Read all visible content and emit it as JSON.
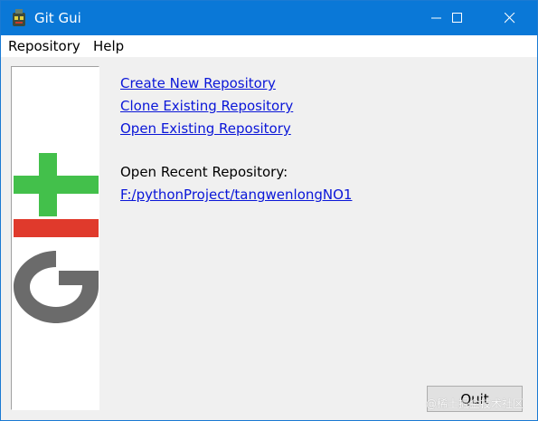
{
  "window": {
    "title": "Git Gui"
  },
  "menubar": {
    "items": [
      {
        "label": "Repository"
      },
      {
        "label": "Help"
      }
    ]
  },
  "actions": {
    "create": "Create New Repository",
    "clone": "Clone Existing Repository",
    "open": "Open Existing Repository"
  },
  "recent": {
    "label": "Open Recent Repository:",
    "items": [
      {
        "path": "F:/pythonProject/tangwenlongNO1"
      }
    ]
  },
  "footer": {
    "quit_label": "Quit",
    "watermark": "@稀土掘金技术社区"
  },
  "colors": {
    "titlebar": "#0a78d7",
    "link": "#0a16d8",
    "logo_green": "#43c04b",
    "logo_red": "#e03a2c",
    "logo_gray": "#6b6b6b"
  },
  "icons": {
    "app": "git-gui-app-icon",
    "minimize": "minimize-icon",
    "maximize": "maximize-icon",
    "close": "close-icon"
  }
}
